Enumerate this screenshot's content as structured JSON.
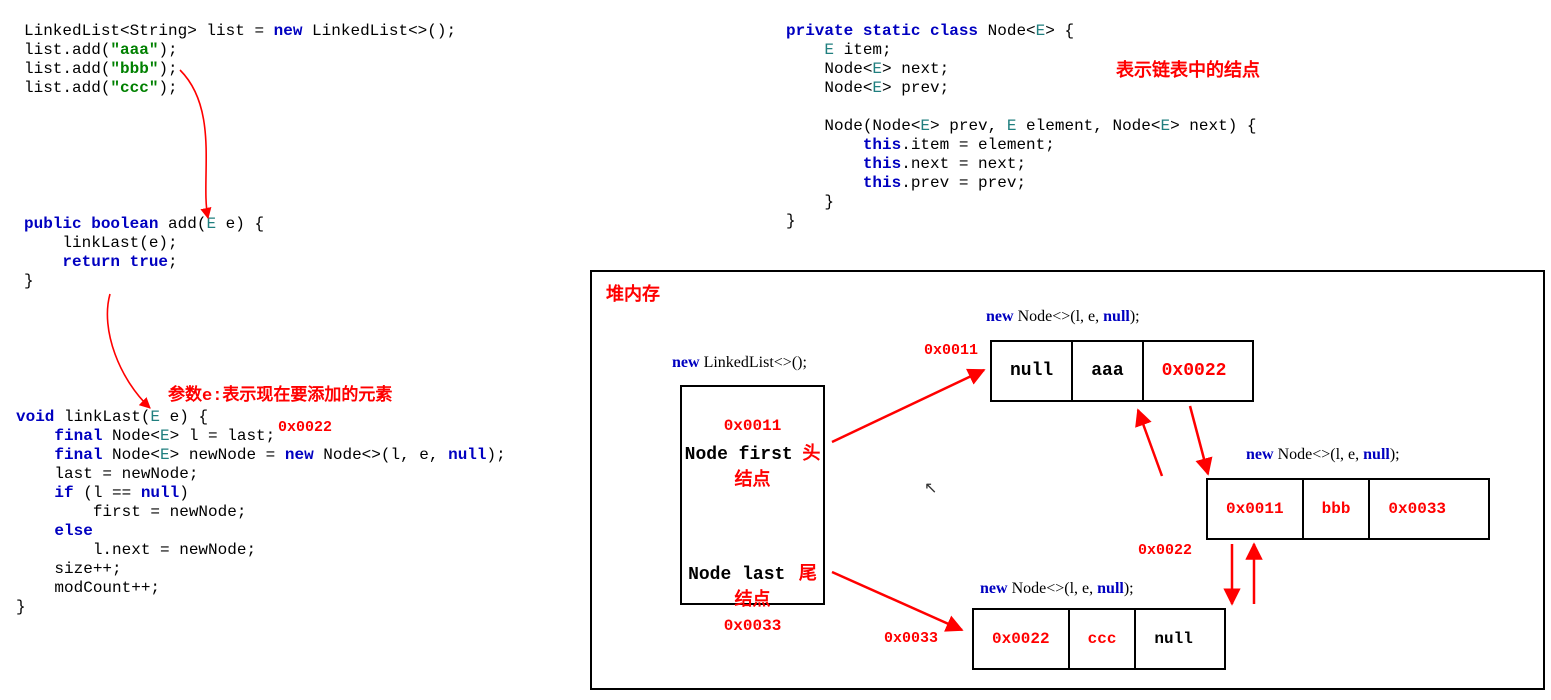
{
  "code_block1": {
    "line1": {
      "pre": "LinkedList<String> list = ",
      "kw": "new",
      "post": " LinkedList<>();"
    },
    "line2": {
      "pre": "list.add(",
      "str": "\"aaa\"",
      "post": ");"
    },
    "line3": {
      "pre": "list.add(",
      "str": "\"bbb\"",
      "post": ");"
    },
    "line4": {
      "pre": "list.add(",
      "str": "\"ccc\"",
      "post": ");"
    }
  },
  "code_block2": {
    "sig": {
      "kw1": "public boolean",
      "name": " add(",
      "tp": "E",
      "rest": " e) {"
    },
    "body1": "    linkLast(e);",
    "body2": {
      "pre": "    ",
      "kw": "return true",
      "post": ";"
    },
    "close": "}"
  },
  "annotation1": "参数e:表示现在要添加的元素",
  "code_block3_addr": "0x0022",
  "code_block3": {
    "sig": {
      "kw": "void",
      "name": " linkLast(",
      "tp": "E",
      "rest": " e) {"
    },
    "l1": {
      "pre": "    ",
      "kw": "final",
      "mid": " Node<",
      "tp": "E",
      "post": "> l = last;"
    },
    "l2": {
      "pre": "    ",
      "kw": "final",
      "mid": " Node<",
      "tp": "E",
      "post1": "> newNode = ",
      "kw2": "new",
      "post2": " Node<>(l, e, ",
      "kw3": "null",
      "post3": ");"
    },
    "l3": "    last = newNode;",
    "l4": {
      "pre": "    ",
      "kw": "if",
      "post": " (l == ",
      "kw2": "null",
      "post2": ")"
    },
    "l5": "        first = newNode;",
    "l6": {
      "pre": "    ",
      "kw": "else"
    },
    "l7": "        l.next = newNode;",
    "l8": "    size++;",
    "l9": "    modCount++;",
    "close": "}"
  },
  "code_block4": {
    "sig": {
      "kw": "private static class",
      "name": " Node<",
      "tp": "E",
      "rest": "> {"
    },
    "l1": {
      "pre": "    ",
      "tp": "E",
      "post": " item;"
    },
    "l2": {
      "pre": "    Node<",
      "tp": "E",
      "post": "> next;"
    },
    "l3": {
      "pre": "    Node<",
      "tp": "E",
      "post": "> prev;"
    },
    "l4": {
      "pre": "    Node(Node<",
      "tp": "E",
      "m1": "> prev, ",
      "tp2": "E",
      "m2": " element, Node<",
      "tp3": "E",
      "m3": "> next) {"
    },
    "l5": {
      "pre": "        ",
      "kw": "this",
      "post": ".item = element;"
    },
    "l6": {
      "pre": "        ",
      "kw": "this",
      "post": ".next = next;"
    },
    "l7": {
      "pre": "        ",
      "kw": "this",
      "post": ".prev = prev;"
    },
    "l8": "    }",
    "close": "}"
  },
  "annotation2": "表示链表中的结点",
  "heap": {
    "title": "堆内存",
    "new_ll_label": "new LinkedList<>();",
    "ll": {
      "first_addr": "0x0011",
      "first_label": "Node first",
      "first_cn": "头结点",
      "last_label": "Node last",
      "last_cn": "尾结点",
      "last_addr": "0x0033"
    },
    "node1_label": "new Node<>(l, e, null);",
    "node1_addr": "0x0011",
    "node1": {
      "prev": "null",
      "item": "aaa",
      "next": "0x0022"
    },
    "node2_label": "new Node<>(l, e, null);",
    "node2_addr": "0x0022",
    "node2": {
      "prev": "0x0011",
      "item": "bbb",
      "next": "0x0033"
    },
    "node3_label": "new Node<>(l, e, null);",
    "node3_addr": "0x0033",
    "node3": {
      "prev": "0x0022",
      "item": "ccc",
      "next": "null"
    }
  }
}
